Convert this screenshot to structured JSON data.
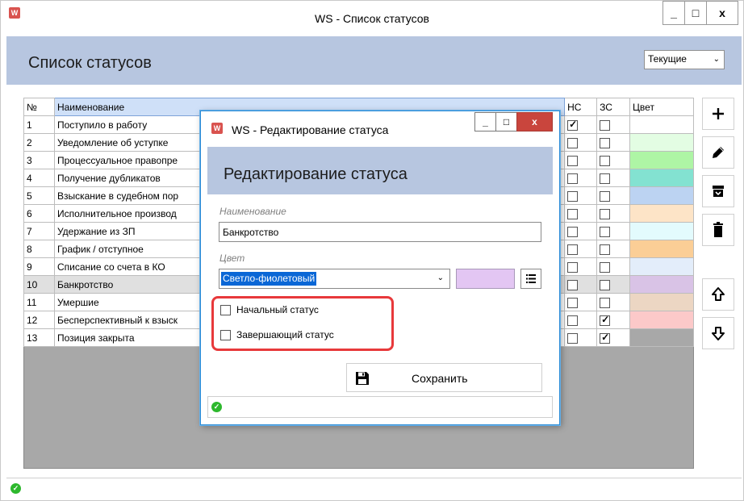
{
  "main": {
    "window_title": "WS - Список статусов",
    "app_icon_text": "W",
    "window_buttons": {
      "minimize": "_",
      "maximize": "□",
      "close": "x"
    },
    "page_title": "Список статусов",
    "filter": {
      "selected": "Текущие"
    },
    "grid": {
      "columns": {
        "num": "№",
        "name": "Наименование",
        "start": "НС",
        "end": "ЗС",
        "color": "Цвет"
      },
      "rows": [
        {
          "num": "1",
          "name": "Поступило в работу",
          "start": true,
          "end": false,
          "color": "#ffffff",
          "selected": false
        },
        {
          "num": "2",
          "name": "Уведомление об уступке",
          "start": false,
          "end": false,
          "color": "#e3fde3",
          "selected": false
        },
        {
          "num": "3",
          "name": "Процессуальное правопре",
          "start": false,
          "end": false,
          "color": "#aef5a5",
          "selected": false
        },
        {
          "num": "4",
          "name": "Получение дубликатов",
          "start": false,
          "end": false,
          "color": "#83e2d1",
          "selected": false
        },
        {
          "num": "5",
          "name": "Взыскание в судебном пор",
          "start": false,
          "end": false,
          "color": "#bcd3f2",
          "selected": false
        },
        {
          "num": "6",
          "name": "Исполнительное производ",
          "start": false,
          "end": false,
          "color": "#fde4c7",
          "selected": false
        },
        {
          "num": "7",
          "name": "Удержание из ЗП",
          "start": false,
          "end": false,
          "color": "#e3fbfd",
          "selected": false
        },
        {
          "num": "8",
          "name": "График / отступное",
          "start": false,
          "end": false,
          "color": "#fbce96",
          "selected": false
        },
        {
          "num": "9",
          "name": "Списание со счета в КО",
          "start": false,
          "end": false,
          "color": "#e3edfa",
          "selected": false
        },
        {
          "num": "10",
          "name": "Банкротство",
          "start": false,
          "end": false,
          "color": "#d9c3e6",
          "selected": true
        },
        {
          "num": "11",
          "name": "Умершие",
          "start": false,
          "end": false,
          "color": "#ecd6c3",
          "selected": false
        },
        {
          "num": "12",
          "name": "Бесперспективный к взыск",
          "start": false,
          "end": true,
          "color": "#fcc9c9",
          "selected": false
        },
        {
          "num": "13",
          "name": "Позиция закрыта",
          "start": false,
          "end": true,
          "color": "#a8a8a8",
          "selected": false
        }
      ]
    },
    "tools": [
      "plus-icon",
      "pencil-icon",
      "archive-icon",
      "trash-icon",
      "arrow-up-icon",
      "arrow-down-icon"
    ],
    "status_icon": "✓"
  },
  "dialog": {
    "window_title": "WS - Редактирование статуса",
    "app_icon_text": "W",
    "window_buttons": {
      "minimize": "_",
      "maximize": "□",
      "close": "x"
    },
    "heading": "Редактирование статуса",
    "name_label": "Наименование",
    "name_value": "Банкротство",
    "color_label": "Цвет",
    "color_value": "Светло-фиолетовый",
    "color_swatch": "#e3c6f3",
    "start_status_label": "Начальный статус",
    "start_status_checked": false,
    "end_status_label": "Завершающий статус",
    "end_status_checked": false,
    "save_label": "Сохранить",
    "status_icon": "✓",
    "highlight_color": "#e8393b"
  }
}
